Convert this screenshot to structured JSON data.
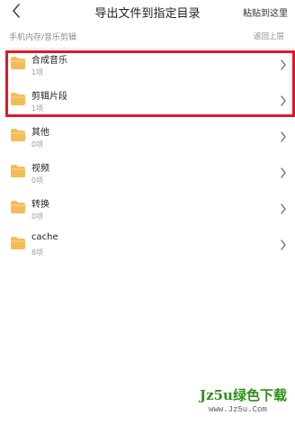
{
  "header": {
    "title": "导出文件到指定目录",
    "paste_label": "粘贴到这里"
  },
  "pathbar": {
    "path": "手机内存/音乐剪辑",
    "up_label": "返回上层"
  },
  "folders": [
    {
      "name": "合成音乐",
      "count": "1项",
      "icon": "folder-icon"
    },
    {
      "name": "剪辑片段",
      "count": "1项",
      "icon": "folder-icon"
    },
    {
      "name": "其他",
      "count": "0项",
      "icon": "folder-icon"
    },
    {
      "name": "视频",
      "count": "0项",
      "icon": "folder-icon"
    },
    {
      "name": "转换",
      "count": "0项",
      "icon": "folder-icon"
    },
    {
      "name": "cache",
      "count": "8项",
      "icon": "folder-icon"
    }
  ],
  "watermark": {
    "brand": "Jz5u绿色下载",
    "url": "www.Jz5u.Com"
  },
  "colors": {
    "folder": "#f5bb55",
    "highlight": "#e0182a",
    "watermark": "#2c8f19"
  }
}
